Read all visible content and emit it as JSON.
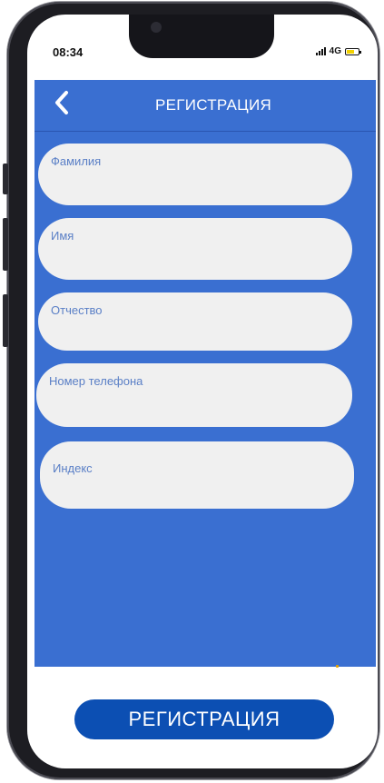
{
  "status_bar": {
    "time": "08:34",
    "network": "4G",
    "battery_color": "#f2d100"
  },
  "header": {
    "back_icon": "chevron-left-icon",
    "title": "РЕГИСТРАЦИЯ"
  },
  "form": {
    "fields": [
      {
        "label": "Фамилия"
      },
      {
        "label": "Имя"
      },
      {
        "label": "Отчество"
      },
      {
        "label": "Номер телефона"
      },
      {
        "label": "Индекс"
      }
    ]
  },
  "submit": {
    "label": "РЕГИСТРАЦИЯ"
  },
  "colors": {
    "primary_blue": "#3a6fd1",
    "button_blue": "#0c4fb3",
    "field_background": "#f0f0f0",
    "label_text": "#5a7fc6"
  }
}
